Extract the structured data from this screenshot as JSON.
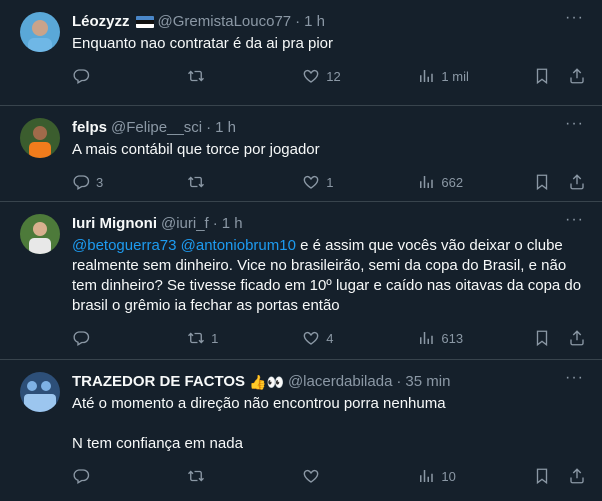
{
  "tweets": [
    {
      "name": "Léozyzz",
      "handle": "@GremistaLouco77",
      "time": "1 h",
      "lines": [
        "Enquanto nao contratar é da ai pra pior"
      ],
      "replies": "",
      "retweets": "",
      "likes": "12",
      "views": "1 mil"
    },
    {
      "name": "felps",
      "handle": "@Felipe__sci",
      "time": "1 h",
      "lines": [
        "A mais contábil que torce por jogador"
      ],
      "replies": "3",
      "retweets": "",
      "likes": "1",
      "views": "662"
    },
    {
      "name": "Iuri Mignoni",
      "handle": "@iuri_f",
      "time": "1 h",
      "mention1": "@betoguerra73",
      "mention2": "@antoniobrum10",
      "line1_rest": "e é assim que vocês vão deixar o clube",
      "lines": [
        "realmente sem dinheiro. Vice no brasileirão, semi da copa do Brasil, e não",
        "tem dinheiro? Se tivesse ficado em 10º lugar e caído nas oitavas da copa do",
        "brasil o grêmio ia fechar as portas então"
      ],
      "replies": "",
      "retweets": "1",
      "likes": "4",
      "views": "613"
    },
    {
      "name": "TRAZEDOR DE FACTOS",
      "emoji": "👍👀",
      "handle": "@lacerdabilada",
      "time": "35 min",
      "lines": [
        "Até o momento a direção não encontrou porra nenhuma",
        "N tem confiança em nada"
      ],
      "replies": "",
      "retweets": "",
      "likes": "",
      "views": "10"
    }
  ],
  "separator": "·",
  "more_glyph": "···"
}
